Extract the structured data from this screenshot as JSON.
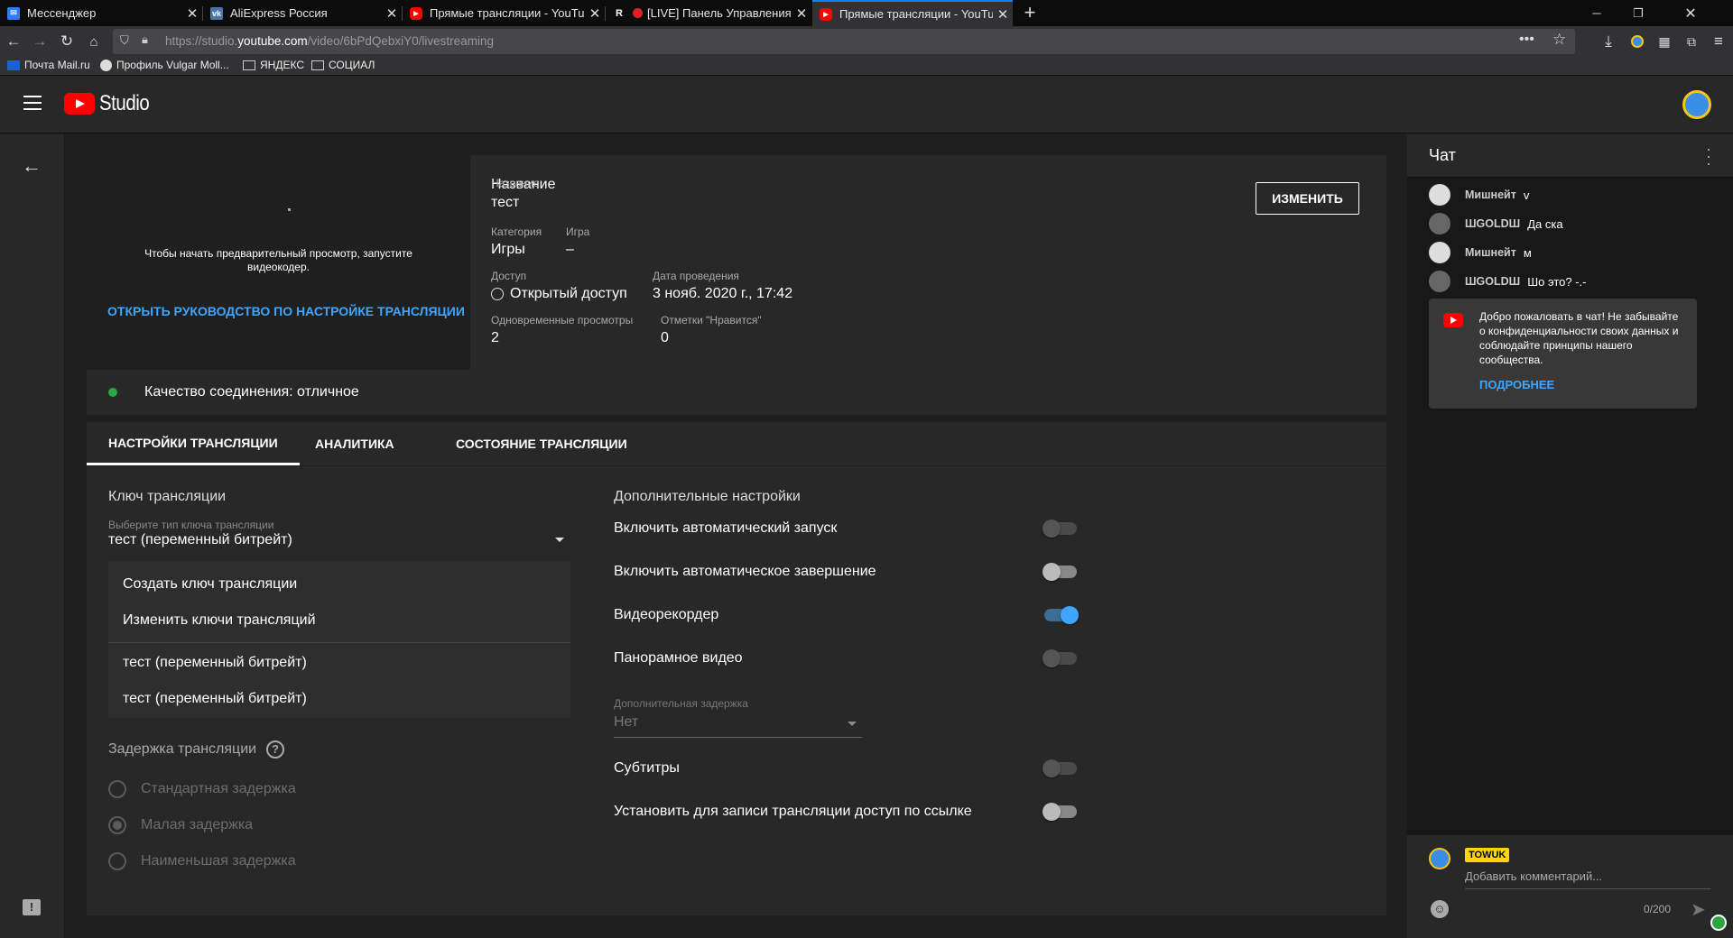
{
  "browser": {
    "tabs": [
      {
        "title": "Мессенджер",
        "icon": "messenger-icon"
      },
      {
        "title": "AliExpress Россия",
        "icon": "vk-icon"
      },
      {
        "title": "Прямые трансляции - YouTube",
        "icon": "youtube-icon"
      },
      {
        "title": "[LIVE] Панель Управления",
        "icon": "r-icon"
      },
      {
        "title": "Прямые трансляции - YouTube",
        "icon": "youtube-icon"
      }
    ],
    "url_prefix": "https://studio.",
    "url_domain": "youtube.com",
    "url_path": "/video/6bPdQebxiY0/livestreaming",
    "bookmarks": [
      "Почта Mail.ru",
      "Профиль Vulgar Moll...",
      "ЯНДЕКС",
      "СОЦИАЛ"
    ]
  },
  "header": {
    "logo_text": "Studio"
  },
  "preview": {
    "message": "Чтобы начать предварительный просмотр, запустите видеокодер.",
    "guide_link": "ОТКРЫТЬ РУКОВОДСТВО ПО НАСТРОЙКЕ ТРАНСЛЯЦИИ"
  },
  "details": {
    "title_label": "Название",
    "title_value": "тест",
    "category_label": "Категория",
    "category_value": "Игры",
    "game_label": "Игра",
    "game_value": "–",
    "access_label": "Доступ",
    "access_value": "Открытый доступ",
    "date_label": "Дата проведения",
    "date_value": "3 нояб. 2020 г., 17:42",
    "viewers_label": "Одновременные просмотры",
    "viewers_value": "2",
    "likes_label": "Отметки \"Нравится\"",
    "likes_value": "0",
    "edit_button": "ИЗМЕНИТЬ"
  },
  "quality": {
    "text": "Качество соединения: отличное",
    "status_color": "#2ba640"
  },
  "tabs": [
    "НАСТРОЙКИ ТРАНСЛЯЦИИ",
    "АНАЛИТИКА",
    "СОСТОЯНИЕ ТРАНСЛЯЦИИ"
  ],
  "stream_key": {
    "heading": "Ключ трансляции",
    "select_label": "Выберите тип ключа трансляции",
    "select_value": "тест (переменный битрейт)",
    "menu": [
      "Создать ключ трансляции",
      "Изменить ключи трансляций",
      "тест (переменный битрейт)",
      "тест (переменный битрейт)"
    ]
  },
  "latency": {
    "heading": "Задержка трансляции",
    "options": [
      "Стандартная задержка",
      "Малая задержка",
      "Наименьшая задержка"
    ],
    "selected_index": 1
  },
  "advanced": {
    "heading": "Дополнительные настройки",
    "toggles": [
      {
        "label": "Включить автоматический запуск",
        "on": false
      },
      {
        "label": "Включить автоматическое завершение",
        "on": false
      },
      {
        "label": "Видеорекордер",
        "on": true
      },
      {
        "label": "Панорамное видео",
        "on": false
      }
    ],
    "delay_label": "Дополнительная задержка",
    "delay_value": "Нет",
    "toggles2": [
      {
        "label": "Субтитры",
        "on": false
      },
      {
        "label": "Установить для записи трансляции доступ по ссылке",
        "on": false
      }
    ]
  },
  "chat": {
    "title": "Чат",
    "messages": [
      {
        "author": "Мишнейт",
        "text": "v"
      },
      {
        "author": "ШGOLDШ",
        "text": "Да ска"
      },
      {
        "author": "Мишнейт",
        "text": "м"
      },
      {
        "author": "ШGOLDШ",
        "text": "Шо это? -.-"
      }
    ],
    "welcome_text": "Добро пожаловать в чат! Не забывайте о конфиденциальности своих данных и соблюдайте принципы нашего сообщества.",
    "welcome_link": "ПОДРОБНЕЕ",
    "user_badge": "TOWUK",
    "input_placeholder": "Добавить комментарий...",
    "counter": "0/200"
  }
}
